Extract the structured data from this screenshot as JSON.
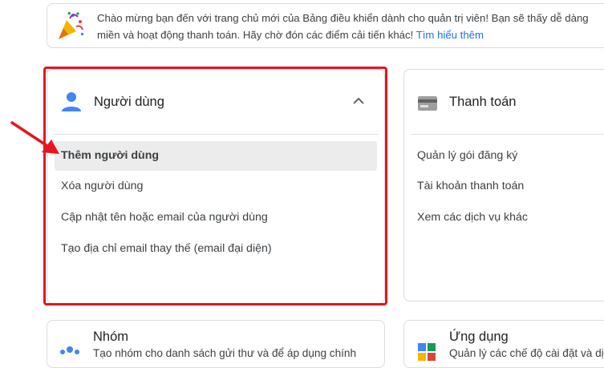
{
  "banner": {
    "line1": "Chào mừng bạn đến với trang chủ mới của Bảng điều khiển dành cho quản trị viên! Bạn sẽ thấy dễ dàng",
    "line2": "miền và hoạt động thanh toán. Hãy chờ đón các điểm cải tiến khác!",
    "link": "Tìm hiểu thêm",
    "icon": "party-popper-icon"
  },
  "users_card": {
    "title": "Người dùng",
    "icon": "person-icon",
    "collapse_icon": "chevron-up-icon",
    "items": [
      {
        "label": "Thêm người dùng",
        "active": true
      },
      {
        "label": "Xóa người dùng"
      },
      {
        "label": "Cập nhật tên hoặc email của người dùng"
      },
      {
        "label": "Tạo địa chỉ email thay thế (email đại diện)"
      }
    ]
  },
  "billing_card": {
    "title": "Thanh toán",
    "icon": "credit-card-icon",
    "items": [
      {
        "label": "Quản lý gói đăng ký"
      },
      {
        "label": "Tài khoản thanh toán"
      },
      {
        "label": "Xem các dịch vụ khác"
      }
    ]
  },
  "groups_card": {
    "title": "Nhóm",
    "icon": "groups-icon",
    "subtitle": "Tạo nhóm cho danh sách gửi thư và để áp dụng chính"
  },
  "apps_card": {
    "title": "Ứng dụng",
    "icon": "apps-grid-icon",
    "subtitle": "Quản lý các chế độ cài đặt và dịch"
  },
  "colors": {
    "annotation_red": "#e8141f",
    "link_blue": "#1a73e8",
    "user_icon_blue": "#4285f4"
  }
}
